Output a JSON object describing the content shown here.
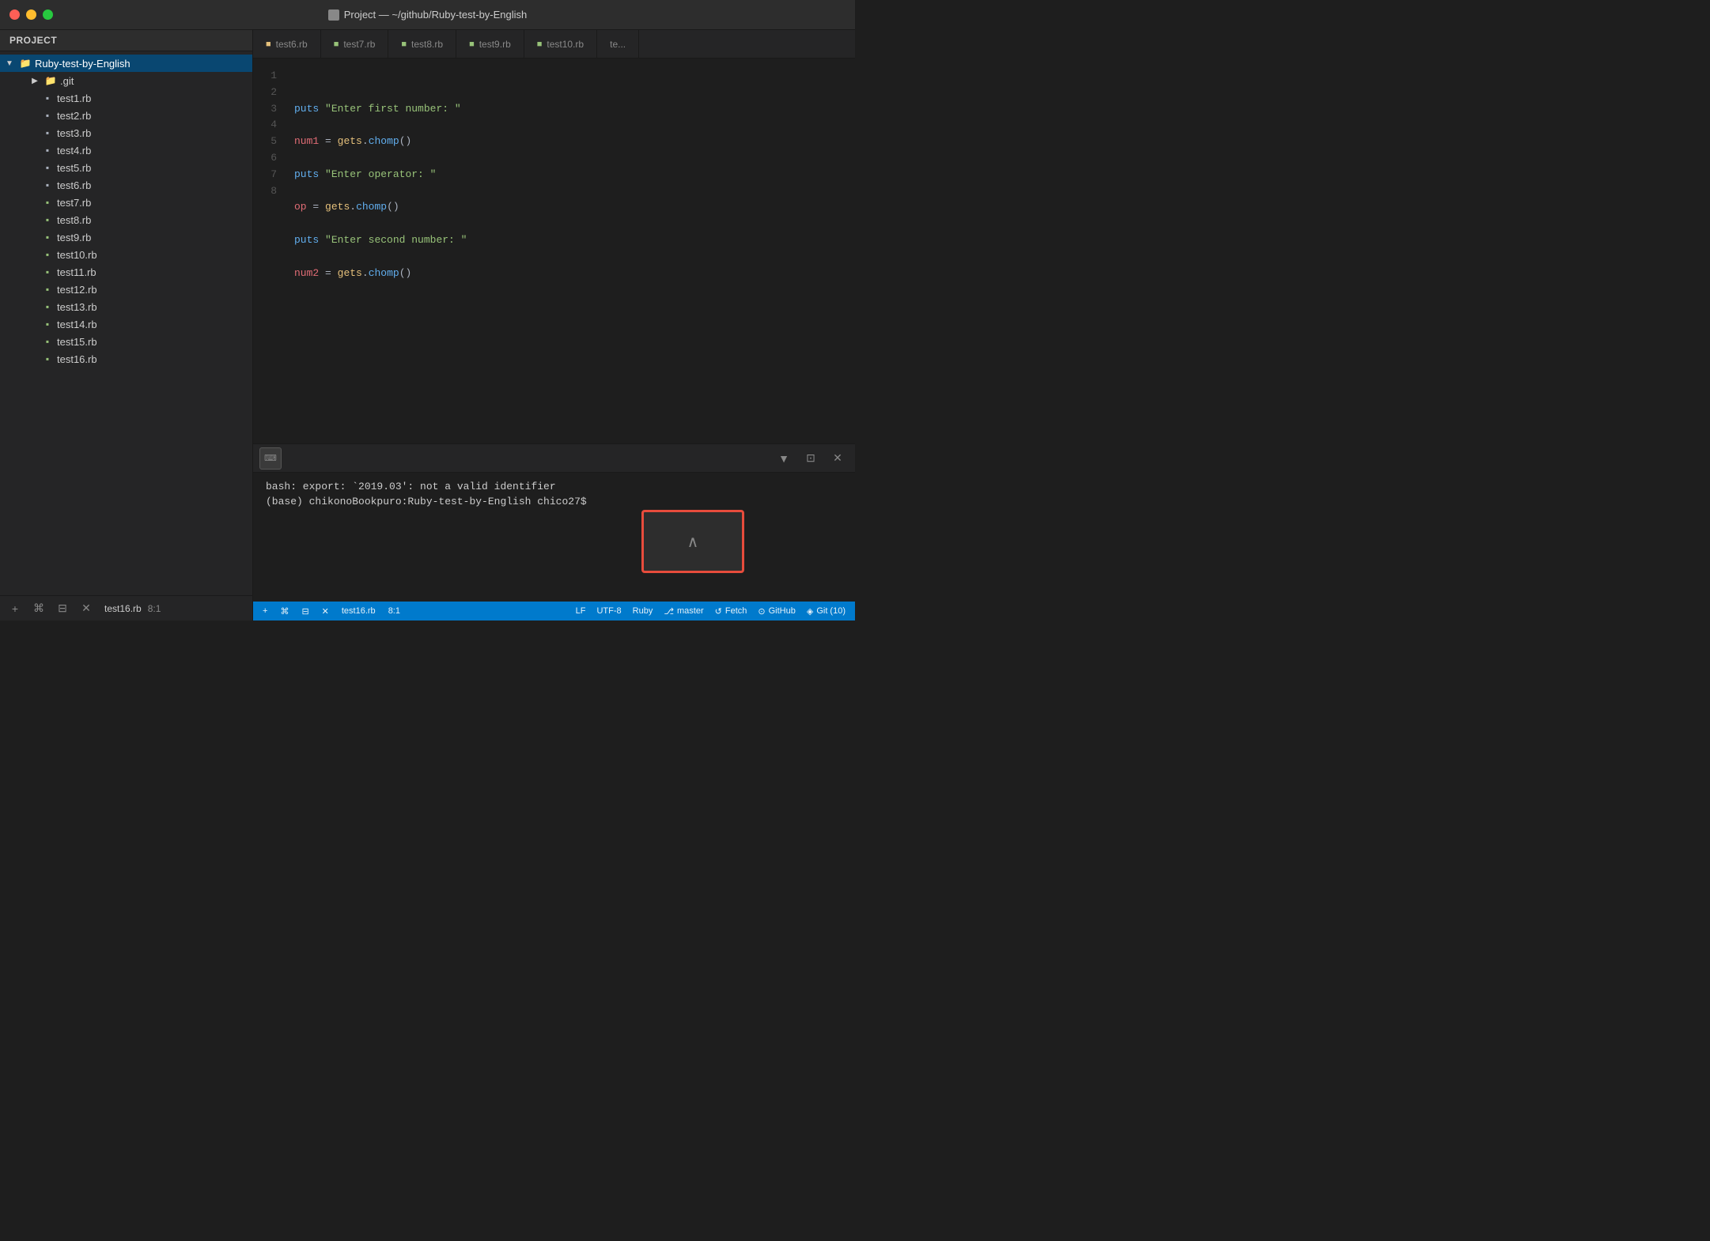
{
  "titleBar": {
    "title": "Project — ~/github/Ruby-test-by-English"
  },
  "sidebar": {
    "header": "Project",
    "rootItem": {
      "label": "Ruby-test-by-English",
      "expanded": true
    },
    "items": [
      {
        "label": ".git",
        "type": "folder",
        "indent": 1
      },
      {
        "label": "test1.rb",
        "type": "file-plain",
        "indent": 2
      },
      {
        "label": "test2.rb",
        "type": "file-plain",
        "indent": 2
      },
      {
        "label": "test3.rb",
        "type": "file-plain",
        "indent": 2
      },
      {
        "label": "test4.rb",
        "type": "file-plain",
        "indent": 2
      },
      {
        "label": "test5.rb",
        "type": "file-plain",
        "indent": 2
      },
      {
        "label": "test6.rb",
        "type": "file-plain",
        "indent": 2
      },
      {
        "label": "test7.rb",
        "type": "file-green",
        "indent": 2
      },
      {
        "label": "test8.rb",
        "type": "file-green",
        "indent": 2
      },
      {
        "label": "test9.rb",
        "type": "file-green",
        "indent": 2
      },
      {
        "label": "test10.rb",
        "type": "file-green",
        "indent": 2
      },
      {
        "label": "test11.rb",
        "type": "file-green",
        "indent": 2
      },
      {
        "label": "test12.rb",
        "type": "file-green",
        "indent": 2
      },
      {
        "label": "test13.rb",
        "type": "file-green",
        "indent": 2
      },
      {
        "label": "test14.rb",
        "type": "file-green",
        "indent": 2
      },
      {
        "label": "test15.rb",
        "type": "file-green",
        "indent": 2
      },
      {
        "label": "test16.rb",
        "type": "file-green",
        "indent": 2
      }
    ],
    "footer": {
      "filename": "test16.rb",
      "position": "8:1"
    }
  },
  "tabs": [
    {
      "label": "test6.rb",
      "active": false
    },
    {
      "label": "test7.rb",
      "active": false
    },
    {
      "label": "test8.rb",
      "active": false
    },
    {
      "label": "test9.rb",
      "active": false
    },
    {
      "label": "test10.rb",
      "active": false
    },
    {
      "label": "te...",
      "active": false
    }
  ],
  "editor": {
    "lines": [
      {
        "num": "1",
        "content": ""
      },
      {
        "num": "2",
        "content": "puts \"Enter first number: \""
      },
      {
        "num": "3",
        "content": "num1 = gets.chomp()"
      },
      {
        "num": "4",
        "content": "puts \"Enter operator: \""
      },
      {
        "num": "5",
        "content": "op = gets.chomp()"
      },
      {
        "num": "6",
        "content": "puts \"Enter second number: \""
      },
      {
        "num": "7",
        "content": "num2 = gets.chomp()"
      },
      {
        "num": "8",
        "content": ""
      }
    ]
  },
  "terminal": {
    "line1": "bash: export: `2019.03': not a valid identifier",
    "line2": "(base) chikonoBookpuro:Ruby-test-by-English chico27$"
  },
  "statusBar": {
    "left": {
      "addBtn": "+",
      "termBtn": "⌘",
      "splitBtn": "⊟",
      "closeBtn": "✕",
      "filename": "test16.rb",
      "position": "8:1"
    },
    "right": {
      "lf": "LF",
      "encoding": "UTF-8",
      "language": "Ruby",
      "branch": "master",
      "fetch": "Fetch",
      "github": "GitHub",
      "git": "Git (10)"
    }
  },
  "colors": {
    "accent": "#007acc",
    "red": "#e74c3c",
    "green": "#98c379",
    "string": "#98c379",
    "keyword": "#61aeee",
    "variable": "#e06c75",
    "method": "#e5c07b"
  }
}
